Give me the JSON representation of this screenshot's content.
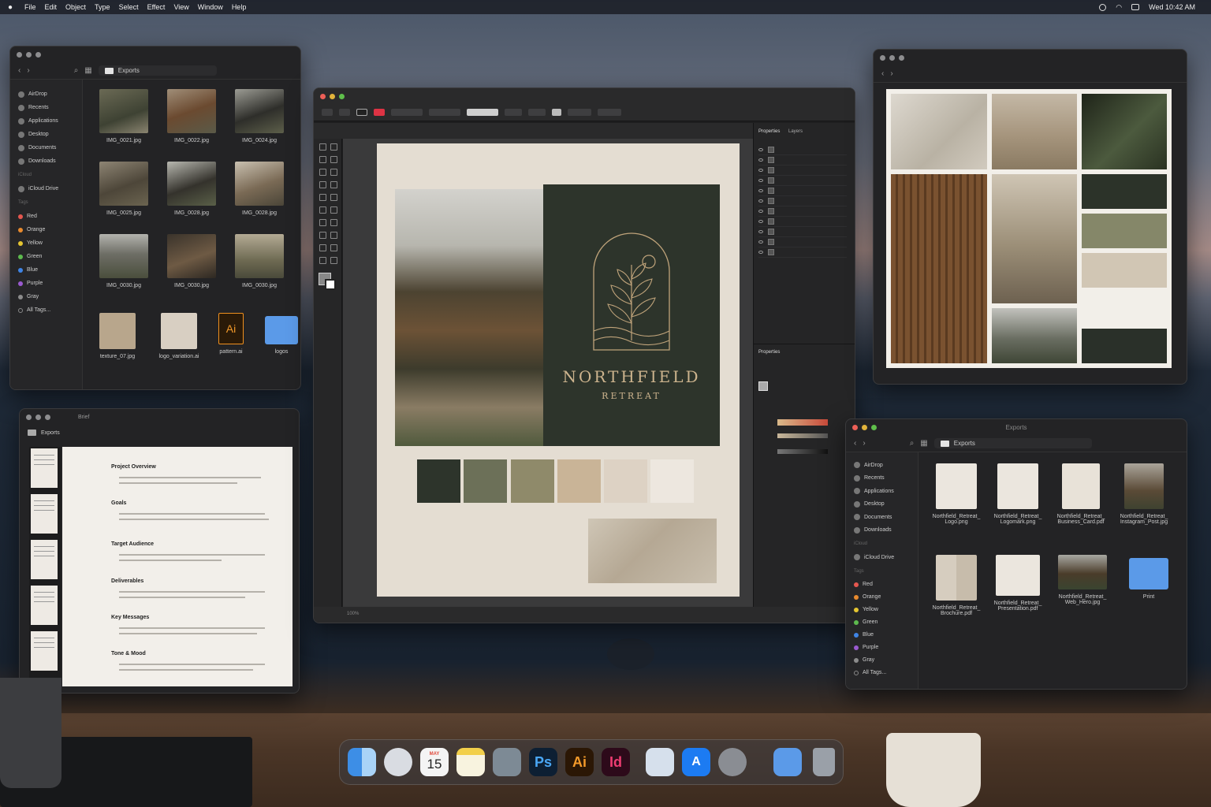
{
  "menubar": {
    "apple": "",
    "items": [
      "File",
      "Edit",
      "Object",
      "Type",
      "Select",
      "Effect",
      "View",
      "Window",
      "Help"
    ],
    "clock": "Wed 10:42 AM"
  },
  "finder_top": {
    "path": "Exports",
    "sidebar": [
      "AirDrop",
      "Recents",
      "Applications",
      "Desktop",
      "Documents",
      "Downloads"
    ],
    "icloud_head": "iCloud",
    "icloud": "iCloud Drive",
    "tags_head": "Tags",
    "tags": [
      {
        "label": "Red",
        "color": "#e5574f"
      },
      {
        "label": "Orange",
        "color": "#e88a2e"
      },
      {
        "label": "Yellow",
        "color": "#e5c531"
      },
      {
        "label": "Green",
        "color": "#5dba4e"
      },
      {
        "label": "Blue",
        "color": "#3f84e5"
      },
      {
        "label": "Purple",
        "color": "#9a5ad0"
      },
      {
        "label": "Gray",
        "color": "#8c8c8c"
      }
    ],
    "all_tags": "All Tags...",
    "files": [
      "IMG_0021.jpg",
      "IMG_0022.jpg",
      "IMG_0024.jpg",
      "IMG_0025.jpg",
      "IMG_0028.jpg",
      "IMG_0028.jpg",
      "IMG_0030.jpg",
      "IMG_0030.jpg",
      "IMG_0030.jpg",
      "texture_07.jpg",
      "logo_variation.ai",
      "pattern.ai",
      "logos"
    ],
    "ai_icon_text": "Ai"
  },
  "illustrator": {
    "artwork": {
      "brand_name": "NORTHFIELD",
      "brand_sub": "RETREAT"
    },
    "panel_tabs": [
      "Properties",
      "Layers"
    ],
    "properties_head": "Properties",
    "swatches": [
      "#2d342b",
      "#6c7058",
      "#8f8a6a",
      "#c9b497",
      "#ddd2c4",
      "#ede7df"
    ],
    "zoom": "100%"
  },
  "moodboard": {
    "swatches": [
      "#2c3329",
      "#858769",
      "#d1c6b4",
      "#2a3029"
    ]
  },
  "brief": {
    "tabs": "Brief",
    "folder": "Exports",
    "sections": [
      "Project Overview",
      "Goals",
      "Target Audience",
      "Deliverables",
      "Key Messages",
      "Tone & Mood"
    ]
  },
  "finder_bottom": {
    "title": "Exports",
    "path": "Exports",
    "sidebar": [
      "AirDrop",
      "Recents",
      "Applications",
      "Desktop",
      "Documents",
      "Downloads"
    ],
    "icloud_head": "iCloud",
    "icloud": "iCloud Drive",
    "tags_head": "Tags",
    "tags": [
      {
        "label": "Red",
        "color": "#e5574f"
      },
      {
        "label": "Orange",
        "color": "#e88a2e"
      },
      {
        "label": "Yellow",
        "color": "#e5c531"
      },
      {
        "label": "Green",
        "color": "#5dba4e"
      },
      {
        "label": "Blue",
        "color": "#3f84e5"
      },
      {
        "label": "Purple",
        "color": "#9a5ad0"
      },
      {
        "label": "Gray",
        "color": "#8c8c8c"
      }
    ],
    "all_tags": "All Tags...",
    "files": [
      {
        "l1": "Northfield_Retreat_",
        "l2": "Logo.png"
      },
      {
        "l1": "Northfield_Retreat_",
        "l2": "Logomark.png"
      },
      {
        "l1": "Northfield_Retreat_",
        "l2": "Business_Card.pdf"
      },
      {
        "l1": "Northfield_Retreat_",
        "l2": "Instagram_Post.jpg"
      },
      {
        "l1": "Northfield_Retreat_",
        "l2": "Brochure.pdf"
      },
      {
        "l1": "Northfield_Retreat_",
        "l2": "Presentation.pdf"
      },
      {
        "l1": "Northfield_Retreat_",
        "l2": "Web_Hero.jpg"
      },
      {
        "l1": "Print",
        "l2": ""
      }
    ]
  },
  "dock": {
    "calendar_month": "MAY",
    "calendar_day": "15",
    "ps": "Ps",
    "ai": "Ai",
    "id": "Id"
  }
}
